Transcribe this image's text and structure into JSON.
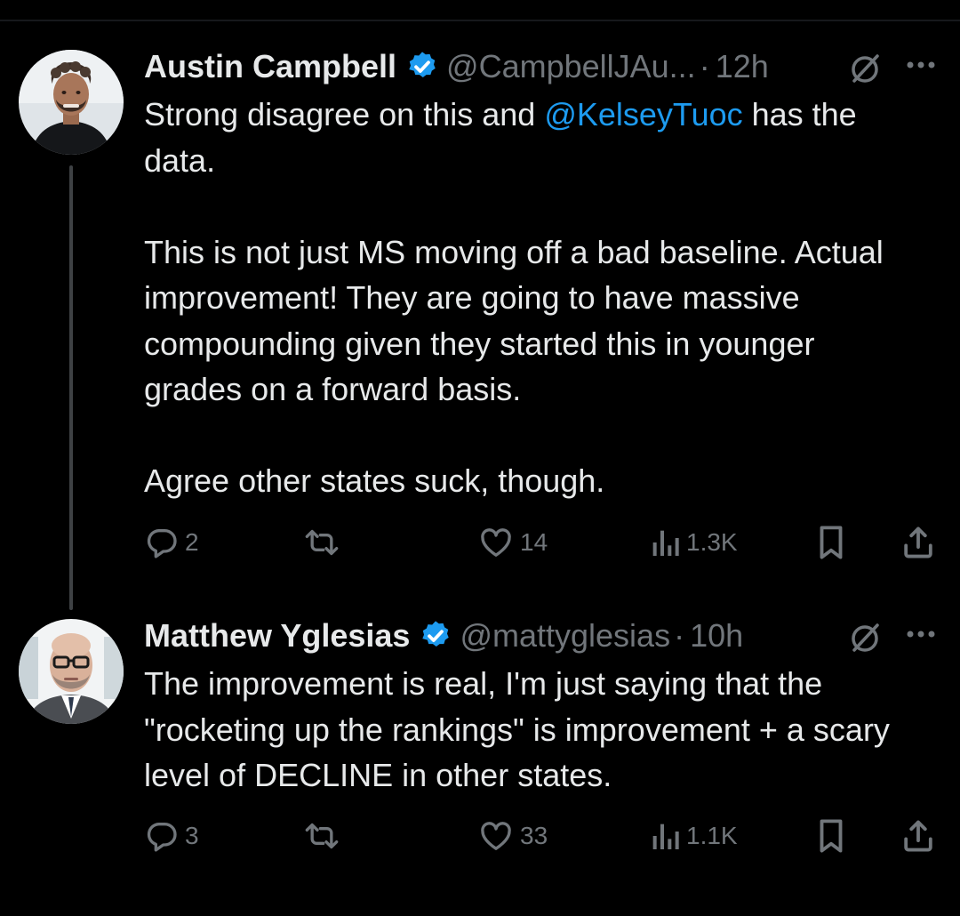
{
  "tweets": [
    {
      "display_name": "Austin Campbell",
      "handle": "@CampbellJAu...",
      "separator": "·",
      "timestamp": "12h",
      "mention": "@KelseyTuoc",
      "text_line1_before": "Strong disagree on this and ",
      "text_line1_after": " has the",
      "text_line2": "data.",
      "paragraph2": "This is not just MS moving off a bad baseline. Actual improvement! They are going to have massive compounding given they started this in younger grades on a forward basis.",
      "paragraph3": "Agree other states suck, though.",
      "replies": "2",
      "reposts": "",
      "likes": "14",
      "views": "1.3K",
      "avatar_icon": "bearded-man-avatar"
    },
    {
      "display_name": "Matthew Yglesias",
      "handle": "@mattyglesias",
      "separator": "·",
      "timestamp": "10h",
      "text": "The improvement is real, I'm just saying that the \"rocketing up the rankings\" is improvement + a scary level of DECLINE in other states.",
      "replies": "3",
      "reposts": "",
      "likes": "33",
      "views": "1.1K",
      "avatar_icon": "bald-man-glasses-avatar"
    }
  ],
  "icons": {
    "verified": "verified-badge-icon",
    "grok": "grok-icon",
    "more": "more-icon",
    "reply": "reply-icon",
    "repost": "repost-icon",
    "like": "like-icon",
    "views": "views-icon",
    "bookmark": "bookmark-icon",
    "share": "share-icon"
  },
  "colors": {
    "background": "#000000",
    "text_primary": "#e7e9ea",
    "text_secondary": "#71767b",
    "accent_blue": "#1d9bf0",
    "thread_line": "#3e4144"
  }
}
